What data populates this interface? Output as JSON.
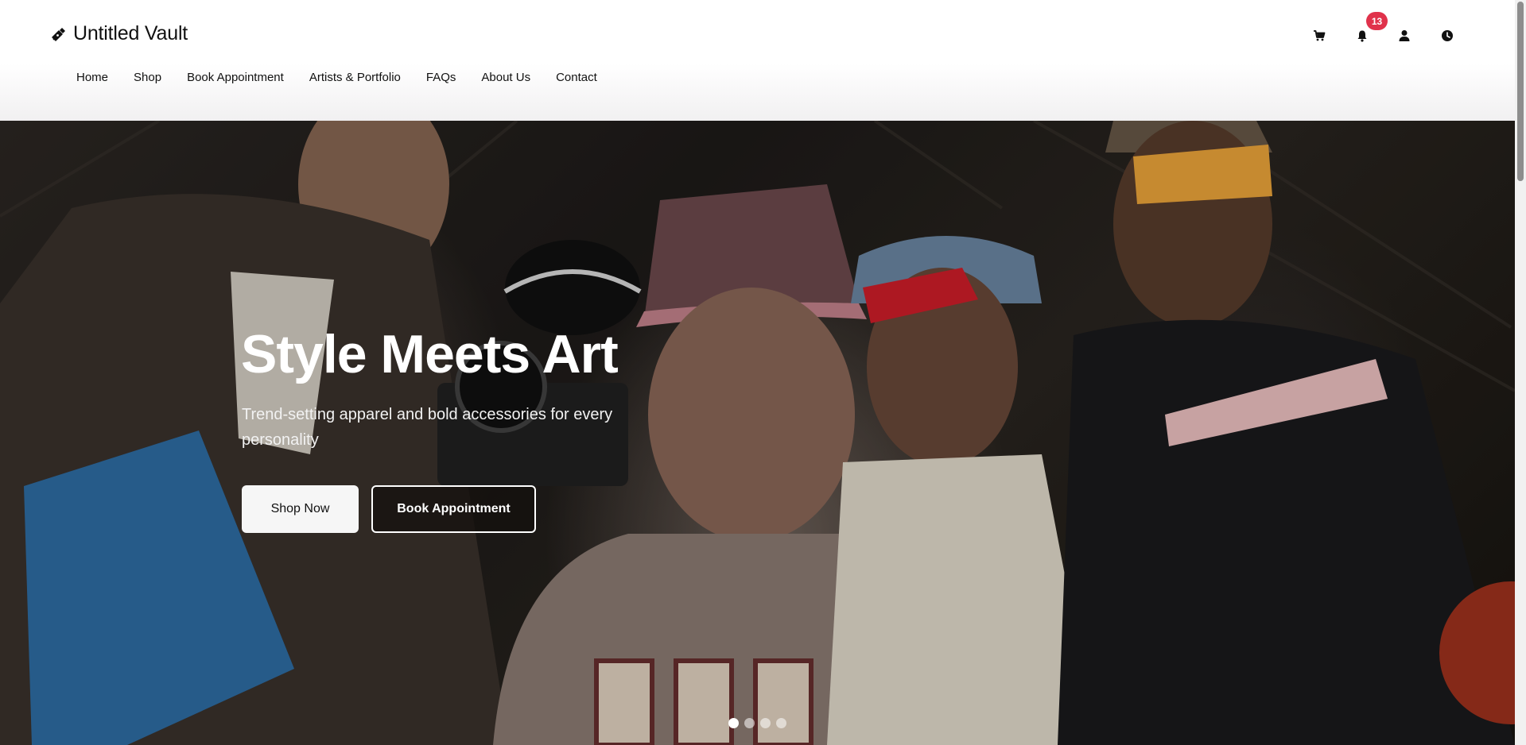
{
  "brand": {
    "name": "Untitled Vault",
    "icon": "pen-nib-icon"
  },
  "nav": {
    "items": [
      {
        "label": "Home"
      },
      {
        "label": "Shop"
      },
      {
        "label": "Book Appointment"
      },
      {
        "label": "Artists & Portfolio"
      },
      {
        "label": "FAQs"
      },
      {
        "label": "About Us"
      },
      {
        "label": "Contact"
      }
    ]
  },
  "header_icons": {
    "cart": "cart-icon",
    "notifications": "bell-icon",
    "notifications_count": "13",
    "account": "user-icon",
    "history": "clock-icon",
    "badge_color": "#e0324b"
  },
  "hero": {
    "title": "Style Meets Art",
    "subtitle": "Trend-setting apparel and bold accessories for every personality",
    "primary_button": "Shop Now",
    "secondary_button": "Book Appointment",
    "slide_count": 4,
    "active_slide": 1
  }
}
